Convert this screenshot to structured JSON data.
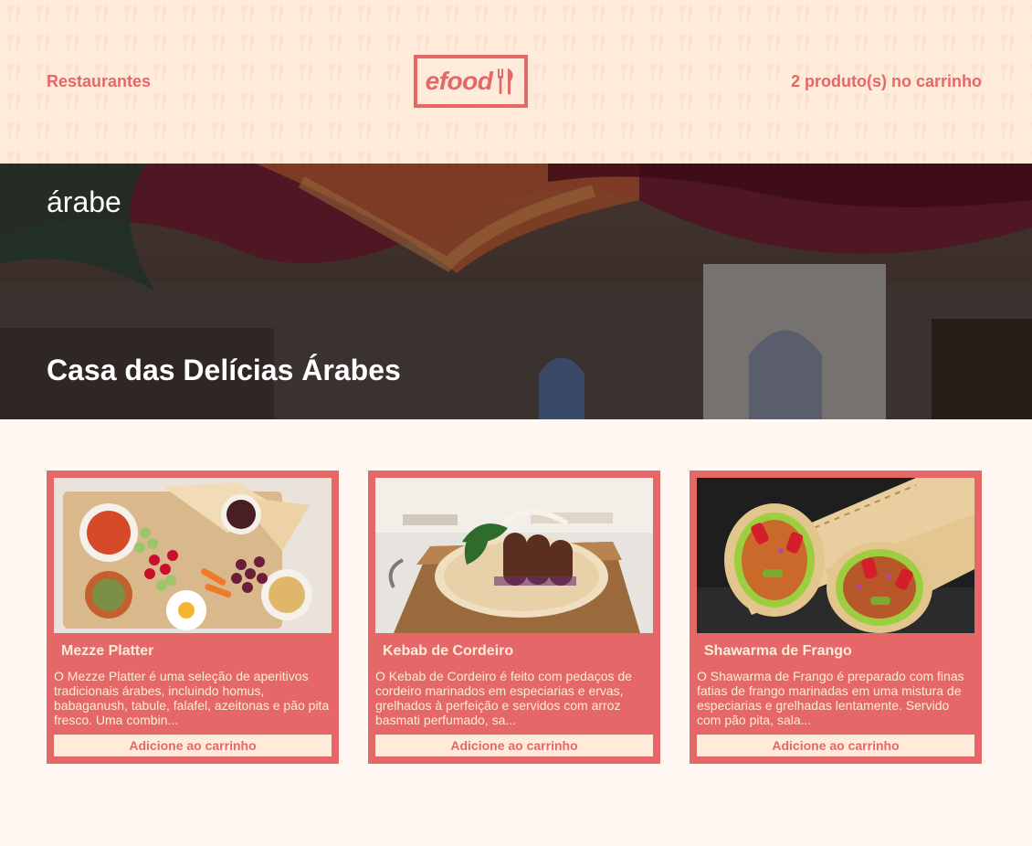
{
  "header": {
    "nav_restaurants": "Restaurantes",
    "logo_text": "efood",
    "cart_label": "2 produto(s) no carrinho"
  },
  "banner": {
    "category": "árabe",
    "restaurant_name": "Casa das Delícias Árabes"
  },
  "products": [
    {
      "title": "Mezze Platter",
      "description": "O Mezze Platter é uma seleção de aperitivos tradicionais árabes, incluindo homus, babaganush, tabule, falafel, azeitonas e pão pita fresco. Uma combin...",
      "button": "Adicione ao carrinho"
    },
    {
      "title": "Kebab de Cordeiro",
      "description": "O Kebab de Cordeiro é feito com pedaços de cordeiro marinados em especiarias e ervas, grelhados à perfeição e servidos com arroz basmati perfumado, sa...",
      "button": "Adicione ao carrinho"
    },
    {
      "title": "Shawarma de Frango",
      "description": "O Shawarma de Frango é preparado com finas fatias de frango marinadas em uma mistura de especiarias e grelhadas lentamente. Servido com pão pita, sala...",
      "button": "Adicione ao carrinho"
    }
  ],
  "colors": {
    "primary": "#E66767",
    "secondary": "#FFEBD9",
    "page_background": "#FFF8F2"
  }
}
